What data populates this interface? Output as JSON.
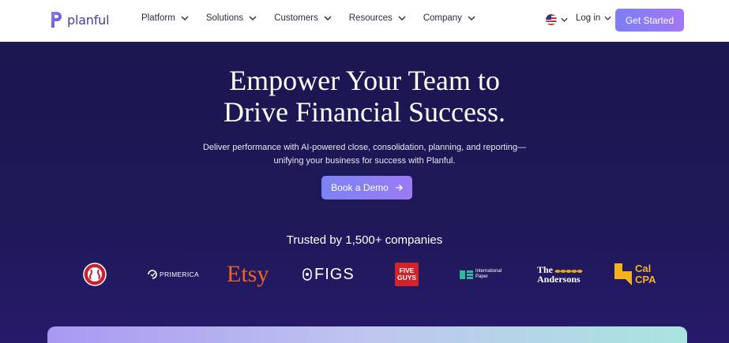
{
  "header": {
    "logo_text": "planful",
    "nav": [
      {
        "label": "Platform"
      },
      {
        "label": "Solutions"
      },
      {
        "label": "Customers"
      },
      {
        "label": "Resources"
      },
      {
        "label": "Company"
      }
    ],
    "login_label": "Log in",
    "cta_label": "Get Started"
  },
  "hero": {
    "title_line1": "Empower Your Team to",
    "title_line2": "Drive Financial Success.",
    "subtitle_line1": "Deliver performance with AI-powered close, consolidation, planning, and reporting—",
    "subtitle_line2": "unifying your business for success with Planful.",
    "demo_label": "Book a Demo",
    "trusted_label": "Trusted by 1,500+ companies"
  },
  "logos": {
    "primerica": "PRIMERICA",
    "etsy": "Etsy",
    "figs": "FIGS",
    "five_guys_1": "FIVE",
    "five_guys_2": "GUYS",
    "ip_1": "International",
    "ip_2": "Paper",
    "andersons_1": "The",
    "andersons_2": "Andersons",
    "calcpa_1": "Cal",
    "calcpa_2": "CPA"
  },
  "colors": {
    "hero_bg": "#1b1750",
    "accent": "#8f7cf5",
    "brand": "#4a3e9e"
  }
}
